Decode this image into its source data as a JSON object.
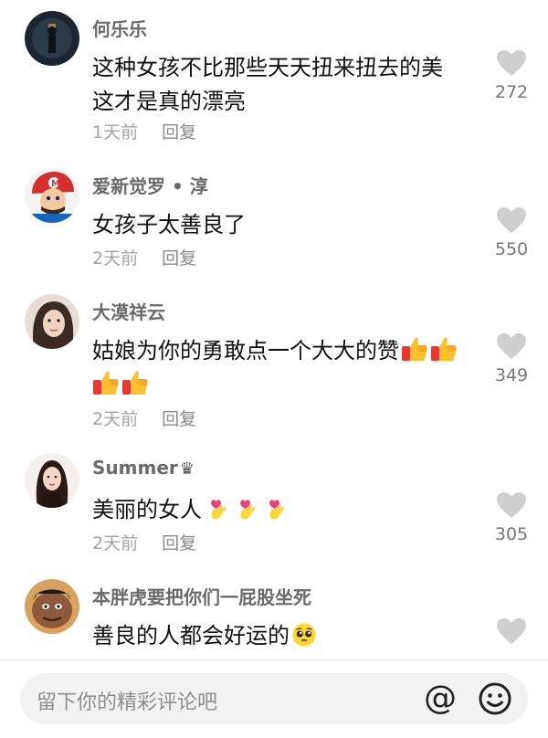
{
  "comments": [
    {
      "username": "何乐乐",
      "text_line1": "这种女孩不比那些天天扭来扭去的美",
      "text_line2": "这才是真的漂亮",
      "time": "1天前",
      "reply": "回复",
      "likes": "272",
      "avatar": "night-silhouette-avatar"
    },
    {
      "username": "爱新觉罗 • 淳",
      "text": "女孩子太善良了",
      "time": "2天前",
      "reply": "回复",
      "likes": "550",
      "avatar": "mario-avatar"
    },
    {
      "username": "大漠祥云",
      "text_line1": "姑娘为你的勇敢点一个大大的赞",
      "emoji_line1": [
        "thumbs-up-emoji",
        "thumbs-up-emoji"
      ],
      "emoji_line2": [
        "thumbs-up-emoji",
        "thumbs-up-emoji"
      ],
      "time": "2天前",
      "reply": "回复",
      "likes": "349",
      "avatar": "girl-portrait-avatar"
    },
    {
      "username": "Summer",
      "username_badge": "♛",
      "text": "美丽的女人",
      "emojis": [
        "finger-heart-emoji",
        "finger-heart-emoji",
        "finger-heart-emoji"
      ],
      "time": "2天前",
      "reply": "回复",
      "likes": "305",
      "avatar": "woman-dark-hair-avatar"
    },
    {
      "username": "本胖虎要把你们一屁股坐死",
      "text": "善良的人都会好运的",
      "emojis": [
        "pleading-face-emoji"
      ],
      "avatar": "gian-cartoon-avatar"
    }
  ],
  "input": {
    "placeholder": "留下你的精彩评论吧",
    "at_symbol": "@"
  },
  "colors": {
    "text": "#111111",
    "username": "#6b6b6b",
    "meta": "#a3a3a3",
    "heart": "#cfcfcf",
    "input_bg": "#f2f2f2"
  }
}
